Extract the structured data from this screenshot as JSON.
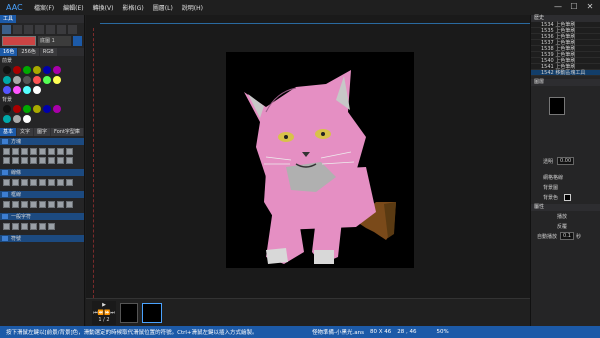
{
  "app": {
    "name": "AAC"
  },
  "menu": [
    "檔案(F)",
    "編輯(E)",
    "轉換(V)",
    "影格(G)",
    "圖層(L)",
    "說明(H)"
  ],
  "window_controls": {
    "minimize": "—",
    "maximize": "☐",
    "close": "✕"
  },
  "left_panel": {
    "tool_label": "工具",
    "color_tabs": [
      "16色",
      "256色",
      "RGB"
    ],
    "fg_label": "前景",
    "bg_label": "背景",
    "char_field_label": "底圖 1",
    "sub_tabs": [
      "基本",
      "文字",
      "圖字",
      "Font字型庫"
    ],
    "section_titles": [
      "方塊",
      "線條",
      "框線",
      "一般字符",
      "符號"
    ]
  },
  "canvas": {
    "width_chars": 80,
    "height_chars": 46
  },
  "right_panel": {
    "history_title": "歷史",
    "history_items": [
      "1534 上色筆刷",
      "1535 上色筆刷",
      "1536 上色筆刷",
      "1537 上色筆刷",
      "1538 上色筆刷",
      "1539 上色筆刷",
      "1540 上色筆刷",
      "1541 上色筆刷",
      "1542 移動區塊工具"
    ],
    "layers_title": "圖層",
    "opacity_label": "透明",
    "opacity_value": "0.00",
    "grid_label": "網格格線",
    "bg_image_label": "背景圖",
    "bg_color_label": "背景色",
    "props_title": "屬性",
    "playback_label": "播放",
    "loop_label": "反覆",
    "autoplay_label": "自動播放",
    "autoplay_value": "0.1",
    "autoplay_unit": "秒"
  },
  "timeline": {
    "frame_counter": "1 / 2"
  },
  "status": {
    "hint": "按下滑鼠左鍵以[前景/背景]色，滑動選定的時候取代滑鼠位置的符號。Ctrl+滑鼠左鍵以插入方式繪製。",
    "filename": "怪物準備-小黑光.ans",
    "size": "80 X 46",
    "cursor": "28 , 46",
    "zoom": "50%"
  },
  "colors": {
    "accent": "#1c5aa8",
    "cat_pink": "#e58fc3",
    "cat_gray": "#b0b0b0"
  }
}
